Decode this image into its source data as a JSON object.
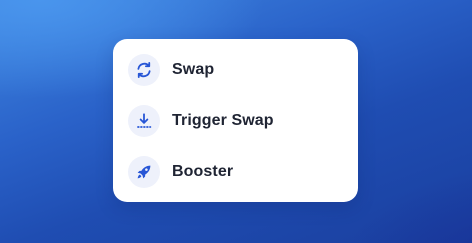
{
  "menu": {
    "items": [
      {
        "label": "Swap",
        "icon": "swap-refresh-icon"
      },
      {
        "label": "Trigger Swap",
        "icon": "download-trigger-icon"
      },
      {
        "label": "Booster",
        "icon": "rocket-icon"
      }
    ]
  },
  "colors": {
    "accent": "#2756d6",
    "icon_bg": "#eef1fb",
    "text": "#1f2433",
    "card": "#ffffff",
    "background_light": "#3f86e0",
    "background_dark": "#1a3f9f"
  }
}
